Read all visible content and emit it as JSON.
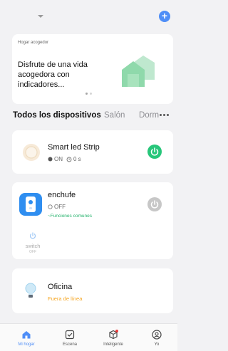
{
  "header": {
    "dropdown_icon": "chevron-down-icon",
    "add_icon": "plus-icon",
    "add_label": "+"
  },
  "banner": {
    "small_label": "Hogar acogedor",
    "title": "Disfrute de una vida acogedora con indicadores...",
    "slides": 2,
    "active_slide": 1
  },
  "tabs": [
    "Todos los dispositivos",
    "Salón",
    "Dorm"
  ],
  "devices": [
    {
      "name": "Smart led Strip",
      "status": "ON",
      "timer": "0 s",
      "icon": "led-strip-icon",
      "power_state": "on"
    },
    {
      "name": "enchufe",
      "status": "OFF",
      "link": "~Funciones comunes",
      "icon": "smart-plug-icon",
      "power_state": "off",
      "sub_switch": {
        "label": "switch",
        "state": "OFF"
      }
    },
    {
      "name": "Oficina",
      "status": "Fuera de línea",
      "icon": "light-bulb-icon"
    }
  ],
  "bottom_nav": [
    {
      "label": "Mi hogar",
      "icon": "home-icon",
      "active": true
    },
    {
      "label": "Escena",
      "icon": "scene-checkbox-icon",
      "active": false
    },
    {
      "label": "Inteligente",
      "icon": "smart-cube-icon",
      "active": false,
      "badge": true
    },
    {
      "label": "Yo",
      "icon": "user-icon",
      "active": false
    }
  ],
  "colors": {
    "accent_blue": "#4f8ef7",
    "power_on_green": "#27c67a",
    "offline_orange": "#f5a623",
    "link_green": "#23b26b"
  }
}
